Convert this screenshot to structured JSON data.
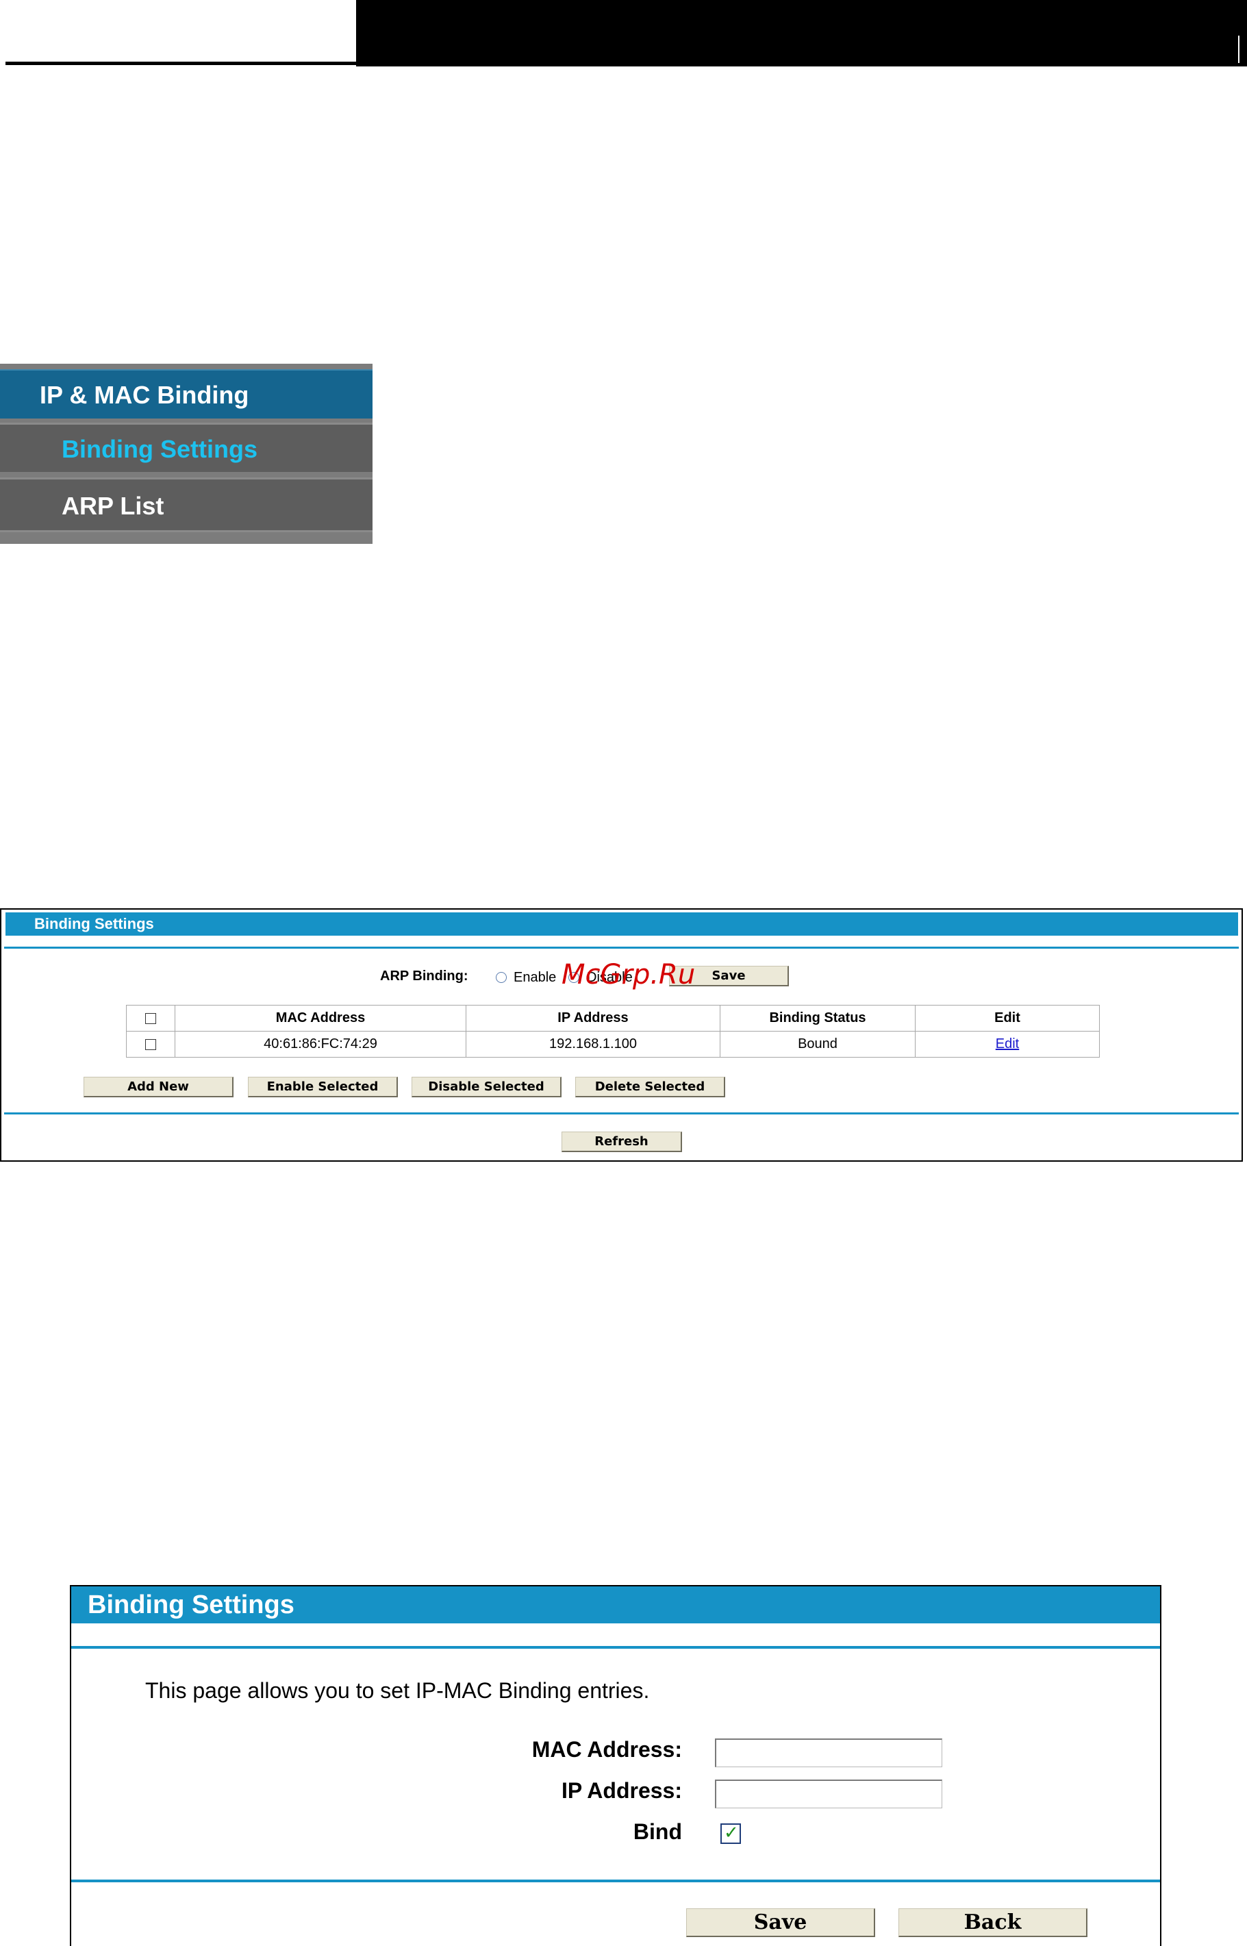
{
  "menu": {
    "top": "IP & MAC Binding",
    "items": [
      "Binding Settings",
      "ARP List"
    ]
  },
  "panel1": {
    "title": "Binding Settings",
    "arp_label": "ARP Binding:",
    "enable": "Enable",
    "disable": "Disable",
    "save": "Save",
    "watermark": "McGrp.Ru",
    "table": {
      "headers": [
        "MAC Address",
        "IP Address",
        "Binding Status",
        "Edit"
      ],
      "rows": [
        {
          "mac": "40:61:86:FC:74:29",
          "ip": "192.168.1.100",
          "status": "Bound",
          "edit": "Edit"
        }
      ]
    },
    "buttons": {
      "add_new": "Add New",
      "enable_selected": "Enable Selected",
      "disable_selected": "Disable Selected",
      "delete_selected": "Delete Selected",
      "refresh": "Refresh"
    }
  },
  "panel2": {
    "title": "Binding Settings",
    "description": "This page allows you to set IP-MAC Binding entries.",
    "mac_label": "MAC Address:",
    "ip_label": "IP Address:",
    "bind_label": "Bind",
    "mac_value": "",
    "ip_value": "",
    "bind_checked": true,
    "save": "Save",
    "back": "Back"
  },
  "colors": {
    "accent": "#1692c6",
    "menu_top": "#15658f",
    "menu_highlight": "#1cc2f0"
  }
}
